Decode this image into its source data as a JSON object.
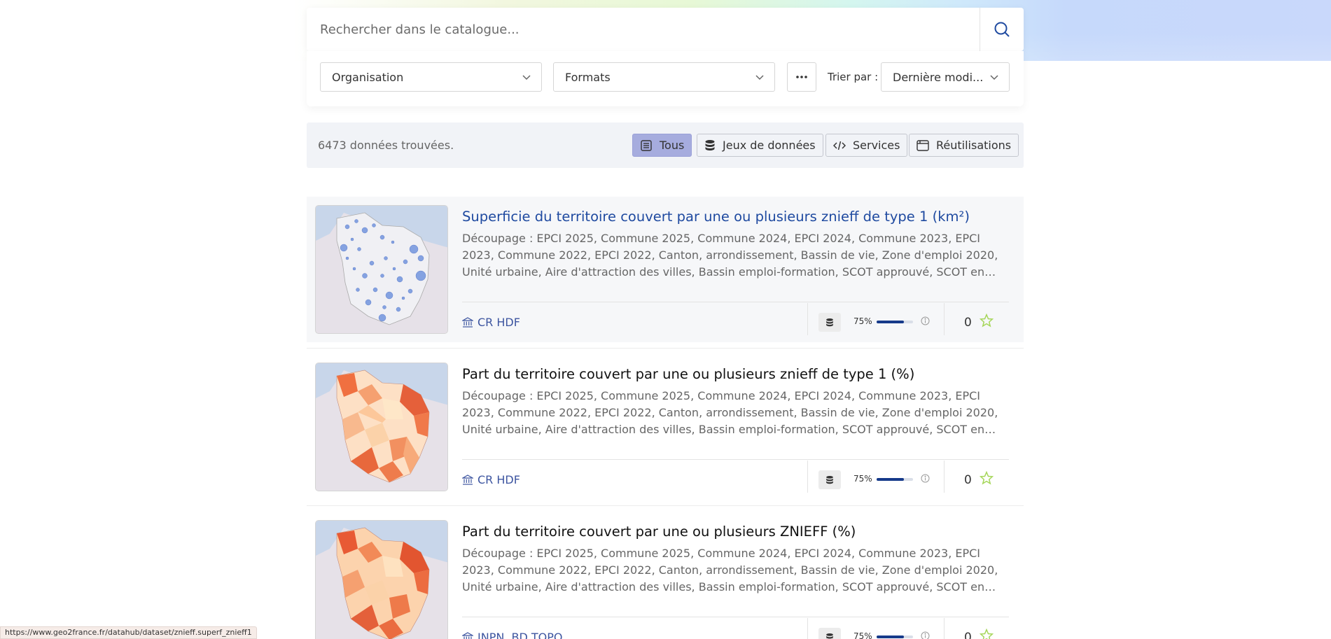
{
  "search": {
    "placeholder": "Rechercher dans le catalogue..."
  },
  "filters": {
    "organisation_label": "Organisation",
    "formats_label": "Formats",
    "sort_label": "Trier par :",
    "sort_value": "Dernière modi..."
  },
  "results": {
    "count_text": "6473 données trouvées.",
    "types": [
      {
        "label": "Tous",
        "active": true
      },
      {
        "label": "Jeux de données",
        "active": false
      },
      {
        "label": "Services",
        "active": false
      },
      {
        "label": "Réutilisations",
        "active": false
      }
    ]
  },
  "datasets": [
    {
      "title": "Superficie du territoire couvert par une ou plusieurs znieff de type 1 (km²)",
      "description": "Découpage : EPCI 2025, Commune 2025, Commune 2024, EPCI 2024, Commune 2023, EPCI 2023, Commune 2022, EPCI 2022, Canton, arrondissement, Bassin de vie, Zone d'emploi 2020, Unité urbaine, Aire d'attraction des villes, Bassin emploi-formation, SCOT approuvé, SCOT en cours, Parc...",
      "organisation": "CR HDF",
      "quality_percent": "75%",
      "quality_fraction": 0.75,
      "favorites": "0",
      "thumbnail": "bubble-map"
    },
    {
      "title": "Part du territoire couvert par une ou plusieurs znieff de type 1 (%)",
      "description": "Découpage : EPCI 2025, Commune 2025, Commune 2024, EPCI 2024, Commune 2023, EPCI 2023, Commune 2022, EPCI 2022, Canton, arrondissement, Bassin de vie, Zone d'emploi 2020, Unité urbaine, Aire d'attraction des villes, Bassin emploi-formation, SCOT approuvé, SCOT en cours, Parc...",
      "organisation": "CR HDF",
      "quality_percent": "75%",
      "quality_fraction": 0.75,
      "favorites": "0",
      "thumbnail": "choropleth-map"
    },
    {
      "title": "Part du territoire couvert par une ou plusieurs ZNIEFF (%)",
      "description": "Découpage : EPCI 2025, Commune 2025, Commune 2024, EPCI 2024, Commune 2023, EPCI 2023, Commune 2022, EPCI 2022, Canton, arrondissement, Bassin de vie, Zone d'emploi 2020, Unité urbaine, Aire d'attraction des villes, Bassin emploi-formation, SCOT approuvé, SCOT en cours, Parc...",
      "organisation": "INPN, BD TOPO",
      "quality_percent": "75%",
      "quality_fraction": 0.75,
      "favorites": "0",
      "thumbnail": "choropleth-map"
    }
  ],
  "status_bar": {
    "url": "https://www.geo2france.fr/datahub/dataset/znieff.superf_znieff1"
  },
  "colors": {
    "accent": "#1f4aa0",
    "active_tab": "#a6acde",
    "bar_fill": "#163a8a",
    "star": "#a6d65a"
  }
}
